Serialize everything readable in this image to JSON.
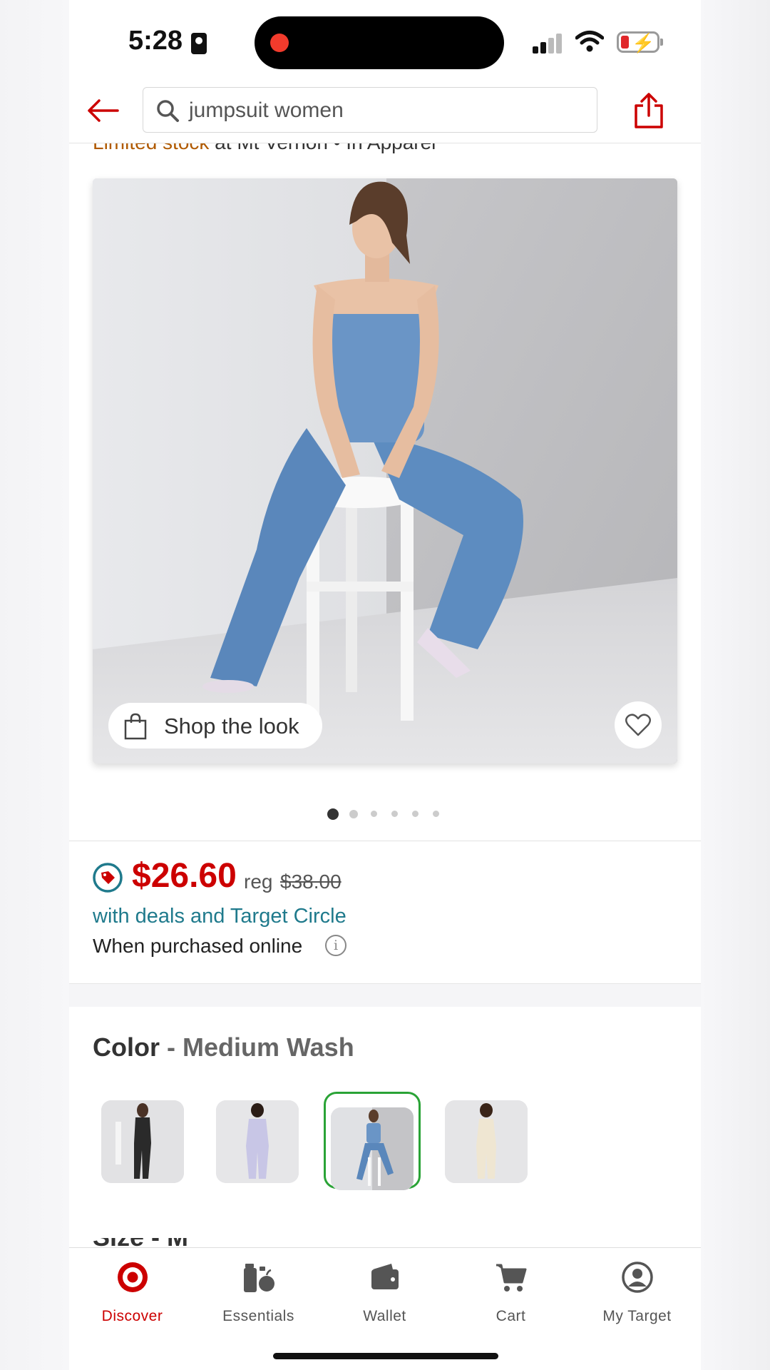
{
  "status_bar": {
    "time": "5:28"
  },
  "search": {
    "query": "jumpsuit women"
  },
  "availability": {
    "stock": "Limited stock",
    "rest": " at Mt Vernon • In Apparel"
  },
  "product": {
    "shop_the_look": "Shop the look",
    "carousel": {
      "count": 6,
      "active": 0
    }
  },
  "price": {
    "current": "$26.60",
    "reg_label": "reg",
    "regular": "$38.00",
    "deals_text": "with deals and Target Circle",
    "online_text": "When purchased online",
    "info_glyph": "i"
  },
  "color": {
    "label": "Color",
    "separator": " - ",
    "selected": "Medium Wash",
    "swatches": [
      "Black",
      "Lavender",
      "Medium Wash",
      "Cream"
    ],
    "selected_index": 2
  },
  "next_section_peek": "Size - M",
  "nav": {
    "items": [
      {
        "label": "Discover",
        "icon": "bullseye-icon",
        "active": true
      },
      {
        "label": "Essentials",
        "icon": "essentials-icon",
        "active": false
      },
      {
        "label": "Wallet",
        "icon": "wallet-icon",
        "active": false
      },
      {
        "label": "Cart",
        "icon": "cart-icon",
        "active": false
      },
      {
        "label": "My Target",
        "icon": "account-icon",
        "active": false
      }
    ]
  },
  "colors": {
    "brand_red": "#cc0000",
    "link_teal": "#1f7a8c",
    "selected_green": "#2aa336"
  }
}
